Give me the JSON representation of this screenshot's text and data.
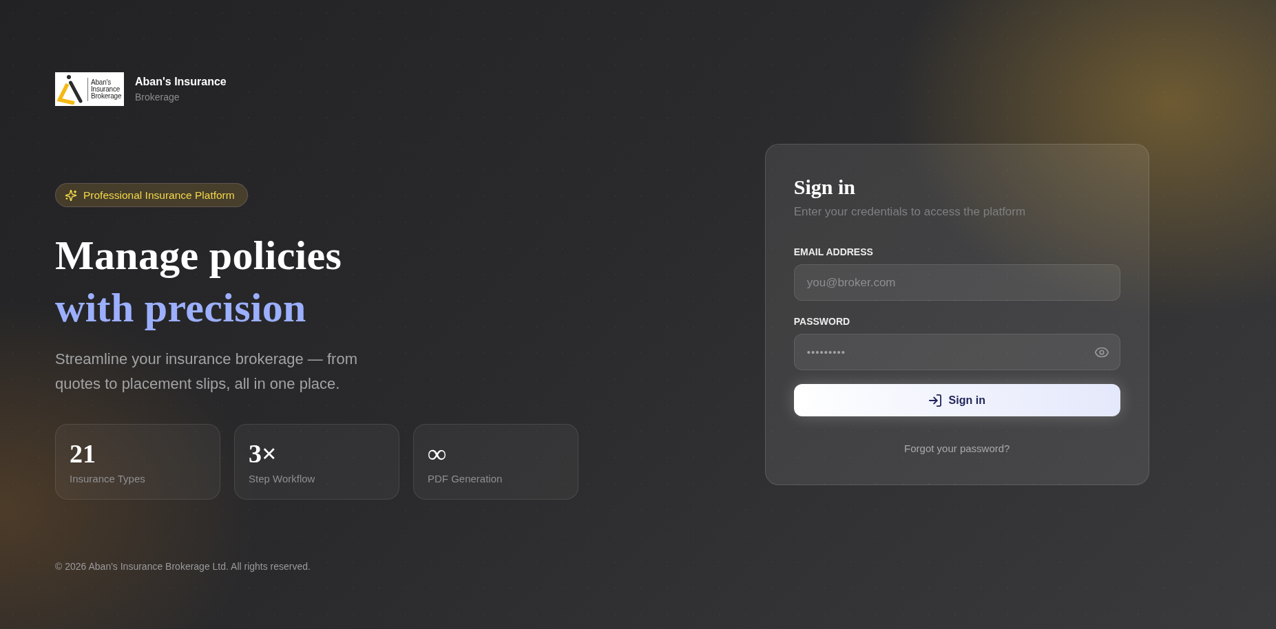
{
  "brand": {
    "logo_text": "Aban's Insurance Brokerage",
    "name": "Aban's Insurance",
    "tagline": "Brokerage"
  },
  "hero": {
    "badge": "Professional Insurance Platform",
    "headline": "Manage policies",
    "headline_accent": "with precision",
    "description": "Streamline your insurance brokerage — from quotes to placement slips, all in one place."
  },
  "stats": [
    {
      "value": "21",
      "label": "Insurance Types"
    },
    {
      "value": "3×",
      "label": "Step Workflow"
    },
    {
      "value": "∞",
      "label": "PDF Generation"
    }
  ],
  "footer": "© 2026 Aban's Insurance Brokerage Ltd. All rights reserved.",
  "sign_in": {
    "title": "Sign in",
    "subtitle": "Enter your credentials to access the platform",
    "fields": [
      {
        "kind": "email",
        "label": "EMAIL ADDRESS",
        "placeholder": "you@broker.com"
      },
      {
        "kind": "password",
        "label": "PASSWORD",
        "placeholder": "•••••••••"
      }
    ],
    "submit": "Sign in",
    "forgot_link": "Forgot your password?"
  }
}
